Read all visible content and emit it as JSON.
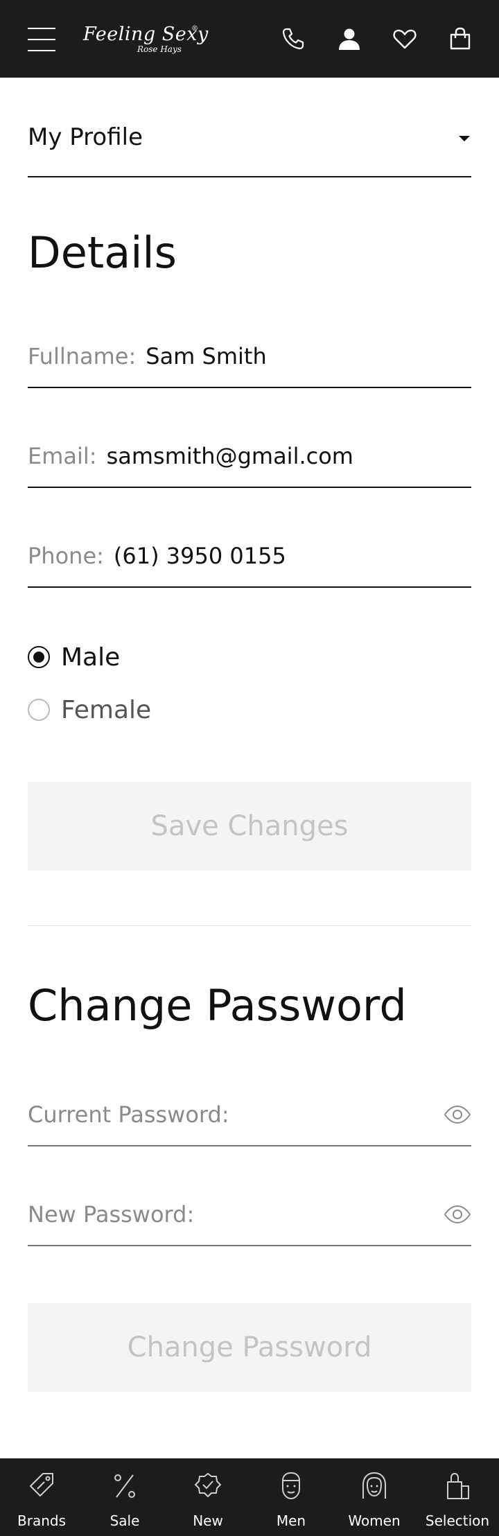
{
  "header": {
    "logo_main": "Feeling Sexy",
    "logo_sub": "Rose Hays",
    "logo_reg": "®",
    "icons": [
      "menu-icon",
      "phone-icon",
      "user-icon",
      "heart-icon",
      "bag-icon"
    ]
  },
  "profile_menu": {
    "selected": "My Profile"
  },
  "details": {
    "title": "Details",
    "fullname_label": "Fullname:",
    "fullname_value": "Sam Smith",
    "email_label": "Email:",
    "email_value": "samsmith@gmail.com",
    "phone_label": "Phone:",
    "phone_value": "(61) 3950 0155",
    "gender_options": [
      "Male",
      "Female"
    ],
    "gender_selected": "Male",
    "save_label": "Save Changes"
  },
  "password": {
    "title": "Change Password",
    "current_label": "Current Password:",
    "new_label": "New Password:",
    "submit_label": "Change Password"
  },
  "bottom_nav": {
    "items": [
      {
        "label": "Brands",
        "icon": "tag-icon"
      },
      {
        "label": "Sale",
        "icon": "percent-icon"
      },
      {
        "label": "New",
        "icon": "badge-check-icon"
      },
      {
        "label": "Men",
        "icon": "man-face-icon"
      },
      {
        "label": "Women",
        "icon": "woman-face-icon"
      },
      {
        "label": "Selection",
        "icon": "shopping-bags-icon"
      }
    ]
  },
  "colors": {
    "header_bg": "#1c1c1c",
    "label_gray": "#8a8a8a",
    "button_bg": "#f4f4f4",
    "button_text": "#c4c4c4"
  }
}
